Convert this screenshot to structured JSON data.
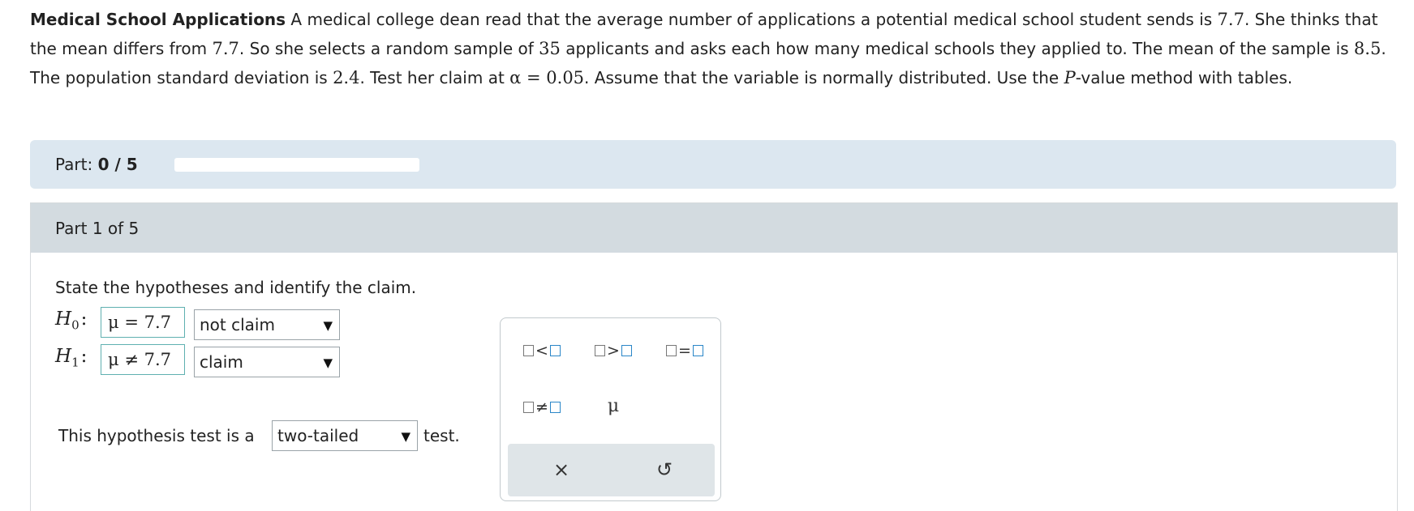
{
  "problem": {
    "title": "Medical School Applications",
    "t1": " A medical college dean read that the average number of applications a potential medical school student sends is ",
    "v1": "7.7",
    "t2": ". She thinks that the mean differs from ",
    "v2": "7.7",
    "t3": ". So she selects a random sample of ",
    "v3": "35",
    "t4": " applicants and asks each how many medical schools they applied to. The mean of the sample is ",
    "v4": "8.5",
    "t5": ". The population standard deviation is ",
    "v5": "2.4",
    "t6": ". Test her claim at ",
    "alpha": "α = 0.05",
    "t7": ". Assume that the variable is normally distributed. Use the ",
    "p": "P",
    "t8": "-value method with tables."
  },
  "progress": {
    "label": "Part:",
    "value": "0 / 5",
    "fraction": 0
  },
  "section": {
    "title": "Part 1 of 5",
    "prompt": "State the hypotheses and identify the claim."
  },
  "h0": {
    "letter": "H",
    "sub": "0",
    "colon": ":",
    "expr": "μ = 7.7",
    "select": "not claim"
  },
  "h1": {
    "letter": "H",
    "sub": "1",
    "colon": ":",
    "expr": "μ ≠ 7.7",
    "select": "claim"
  },
  "test": {
    "pre": "This hypothesis test is a",
    "select": "two-tailed",
    "post": "test."
  },
  "palette": {
    "lt": "<",
    "gt": ">",
    "eq": "=",
    "ne": "≠",
    "mu": "μ",
    "clear": "×",
    "undo": "↺"
  },
  "icons": {
    "dropdown": "caret-down-icon",
    "clear": "close-icon",
    "undo": "undo-icon"
  },
  "colors": {
    "progress_bg": "#dce7f0",
    "header_bg": "#d3dbe0",
    "input_border": "#5fb0b0",
    "accent_blue": "#2a86c8"
  }
}
